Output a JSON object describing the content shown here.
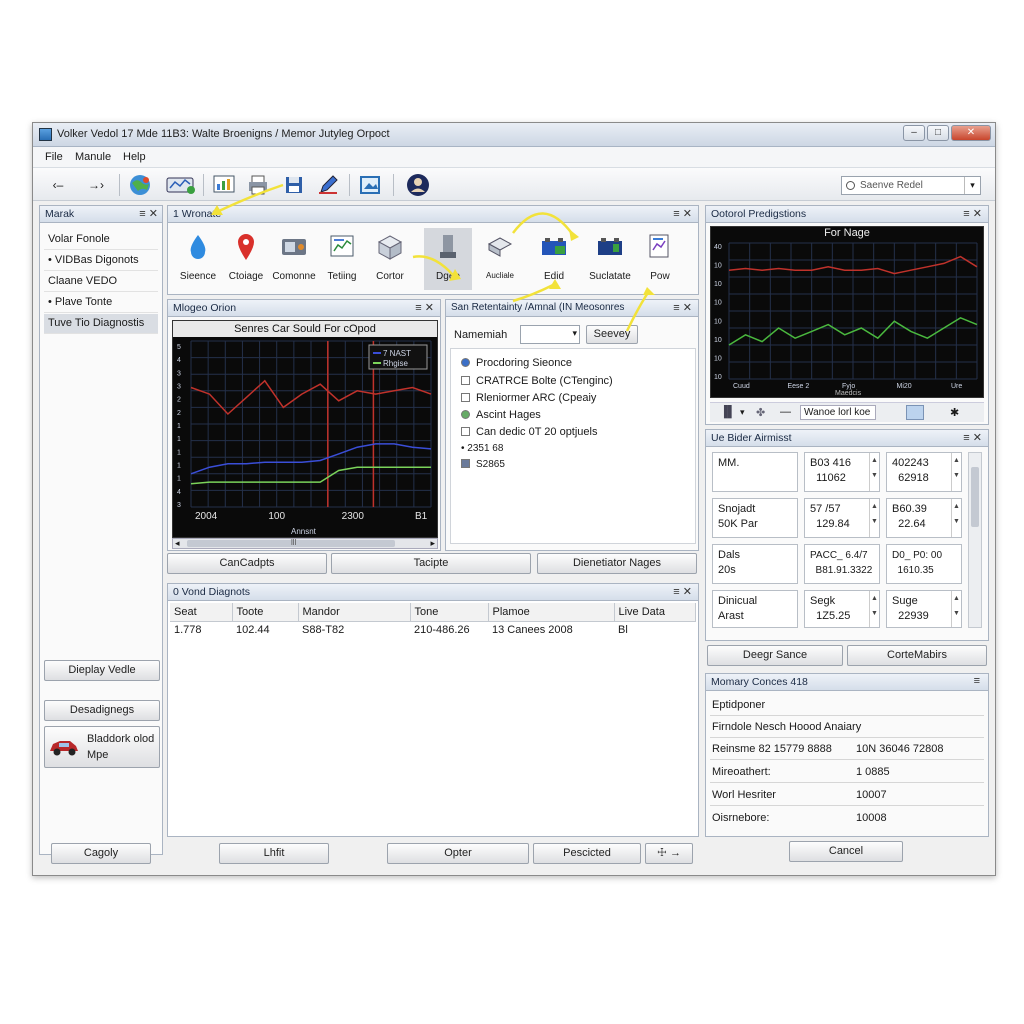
{
  "window": {
    "title": "Volker Vedol 17 Mde 11B3: Walte Broenigns / Memor Jutyleg Orpoct",
    "controls": [
      "–",
      "□",
      "✕"
    ]
  },
  "menu": [
    "File",
    "Manule",
    "Help"
  ],
  "toolbar": {
    "nav_back": "‹–",
    "nav_forward": "→›",
    "search_placeholder": "Saenve Redel",
    "search_drop": "▾"
  },
  "sidebar": {
    "title": "Marak",
    "ctrl": "≡ ✕",
    "items": [
      {
        "label": "Volar Fonole"
      },
      {
        "label": "• VIDBas Digonots"
      },
      {
        "label": "Claane VEDO"
      },
      {
        "label": "• Plave Tonte"
      },
      {
        "label": "Tuve Tio Diagnostis"
      }
    ],
    "btn_display": "Dieplay Vedle",
    "btn_diagnostics": "Desadignegs",
    "vehicle_label_1": "Bladdork olod",
    "vehicle_label_2": "Mpe"
  },
  "wizard": {
    "title": "1 Wronate",
    "ctrl": "≡ ✕",
    "items": [
      {
        "label": "Sieence",
        "icon": "water-drop-icon"
      },
      {
        "label": "Ctoiage",
        "icon": "map-pin-icon"
      },
      {
        "label": "Comonne",
        "icon": "device-icon"
      },
      {
        "label": "Tetiing",
        "icon": "report-icon"
      },
      {
        "label": "Cortor",
        "icon": "box-icon"
      },
      {
        "label": "Dgee",
        "icon": "tool-icon"
      },
      {
        "label": "Aucliale",
        "icon": "car-part-icon"
      },
      {
        "label": "Edid",
        "icon": "battery-icon"
      },
      {
        "label": "Suclatate",
        "icon": "battery-icon"
      },
      {
        "label": "Pow",
        "icon": "document-icon"
      }
    ]
  },
  "chart_panel": {
    "title": "Mlogeo Orion",
    "ctrl": "≡ ✕",
    "chart_title": "Senres Car Sould For cOpod",
    "legend": [
      "7 NAST",
      "Rhgise"
    ],
    "x_ticks": [
      "2004",
      "100",
      "2300",
      "B1"
    ],
    "x_label": "Annsnt",
    "y_ticks": [
      "5",
      "4",
      "3",
      "3",
      "2",
      "2",
      "1",
      "1",
      "1",
      "1",
      "1",
      "4",
      "3"
    ],
    "scroll_arrow_l": "◂",
    "scroll_arrow_r": "▸",
    "scroll_marker": "lll"
  },
  "chart_data": [
    {
      "type": "line",
      "title": "Senres Car Sould For cOpod",
      "xlabel": "Annsnt",
      "x_ticks": [
        "2004",
        "100",
        "2300",
        "B1"
      ],
      "legend": [
        "7 NAST",
        "Rhgise"
      ],
      "series": [
        {
          "color": "#c0322b",
          "values": [
            3.6,
            3.4,
            2.8,
            3.3,
            3.8,
            3.0,
            3.4,
            3.7,
            3.2,
            3.5,
            3.4,
            3.5,
            3.6,
            3.4
          ]
        },
        {
          "color": "#3a4ed8",
          "values": [
            1.0,
            1.2,
            1.3,
            1.3,
            1.35,
            1.35,
            1.35,
            1.4,
            1.6,
            1.8,
            1.9,
            1.9,
            1.8,
            1.75
          ]
        },
        {
          "color": "#7bd35a",
          "values": [
            0.7,
            0.75,
            0.75,
            0.75,
            0.75,
            0.75,
            0.75,
            0.75,
            1.1,
            1.2,
            1.2,
            1.2,
            1.2,
            1.2
          ]
        }
      ],
      "vlines_color": "#c0322b"
    },
    {
      "type": "line",
      "title": "For Nage",
      "y_ticks": [
        "40",
        "10",
        "10",
        "10",
        "10",
        "10",
        "10",
        "10"
      ],
      "x_ticks": [
        "Cuud",
        "Eese 2",
        "Fyjo",
        "Mi20",
        "Ure"
      ],
      "x_sub": "Maedcis",
      "series": [
        {
          "color": "#c0322b",
          "values": [
            3.2,
            3.25,
            3.2,
            3.25,
            3.2,
            3.2,
            3.3,
            3.2,
            3.2,
            3.25,
            3.1,
            3.2,
            3.3,
            3.4,
            3.6,
            3.3
          ]
        },
        {
          "color": "#4ab83e",
          "values": [
            1.0,
            1.3,
            1.1,
            1.5,
            1.2,
            1.4,
            1.6,
            1.3,
            1.5,
            1.2,
            1.7,
            1.4,
            1.2,
            1.5,
            1.8,
            1.6
          ]
        }
      ]
    }
  ],
  "search_panel": {
    "title": "San Retentainty /Amnal (IN Meosonres",
    "ctrl": "≡ ✕",
    "name_label": "Namemiah",
    "name_drop": "▾",
    "search_btn": "Seevey",
    "options": [
      {
        "label": "Procdoring Sieonce",
        "mark": "dot"
      },
      {
        "label": "CRATRCE Bolte (CTenginc)",
        "mark": "box"
      },
      {
        "label": "Rleniormer ARC (Cpeaiy",
        "mark": "box"
      },
      {
        "label": "Ascint Hages",
        "mark": "green"
      },
      {
        "label": "Can dedic 0T 20 optjuels",
        "mark": "box"
      },
      {
        "label": "• 2351 68",
        "mark": "none"
      },
      {
        "label": "S2865",
        "mark": "box"
      }
    ]
  },
  "bottom_bar_mid": {
    "b1": "CanCadpts",
    "b2": "Tacipte",
    "b3": "Dienetiator Nages"
  },
  "diag_panel": {
    "title": "0 Vond Diagnots",
    "ctrl": "≡ ✕",
    "columns": [
      "Seat",
      "Toote",
      "Mandor",
      "Tone",
      "Plamoe",
      "Live Data"
    ],
    "rows": [
      [
        "1.778",
        "102.44",
        "S88-T82",
        "210-486.26",
        "13 Canees 2008",
        "Bl"
      ]
    ]
  },
  "perf_panel": {
    "title": "Ootorol Predigstions",
    "ctrl": "≡ ✕",
    "chart_title": "For Nage",
    "footer_text": "Wanoe lorl koe",
    "footer_icons": [
      "▐▌",
      "▾",
      "✤",
      "—",
      "✱"
    ]
  },
  "assist_panel": {
    "title": "Ue Bider Airmisst",
    "ctrl": "≡ ✕",
    "cells": [
      {
        "text": "MM.",
        "spin": false
      },
      {
        "text": "B03 416\n  11062",
        "spin": true
      },
      {
        "text": "402243\n  62918",
        "spin": true
      },
      {
        "text": "Snojadt\n50K Par",
        "spin": false
      },
      {
        "text": "57 /57\n  129.84",
        "spin": true
      },
      {
        "text": "B60.39\n  22.64",
        "spin": true
      },
      {
        "text": "Dals\n20s",
        "spin": false
      },
      {
        "text": "PACC_ 6.4/7\n  B81.91.3322",
        "spin": false
      },
      {
        "text": "D0_ P0: 00\n  1610.35",
        "spin": false
      },
      {
        "text": "Dinicual\nArast",
        "spin": false
      },
      {
        "text": "Segk\n  1Z5.25",
        "spin": true
      },
      {
        "text": "Suge\n  22939",
        "spin": true
      }
    ],
    "btn1": "Deegr Sance",
    "btn2": "CorteMabirs"
  },
  "memory_panel": {
    "title": "Momary Conces 418",
    "ctrl": "≡",
    "rows": [
      {
        "k": "Eptidponer",
        "v": ""
      },
      {
        "k": "Firndole Nesch Hoood Anaiary",
        "v": ""
      },
      {
        "k": "Reinsme 82 15779 8888",
        "v": "10N 36046 72808"
      },
      {
        "k": "Mireoathert:",
        "v": "1 0885"
      },
      {
        "k": "Worl Hesriter",
        "v": "10007"
      },
      {
        "k": "Oisrnebore:",
        "v": "10008"
      }
    ]
  },
  "footer": {
    "b1": "Cagoly",
    "b2": "Lhfit",
    "b3": "Opter",
    "b4": "Pescicted",
    "b5": "☩ →",
    "b6": "Cancel"
  }
}
